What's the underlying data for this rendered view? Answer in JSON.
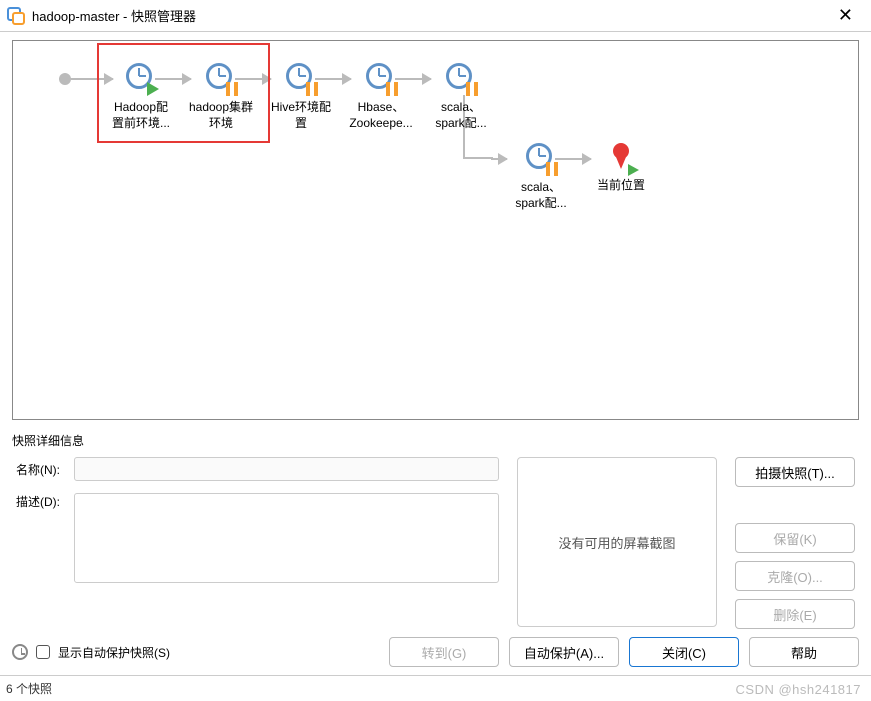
{
  "window": {
    "title": "hadoop-master - 快照管理器",
    "close_glyph": "✕"
  },
  "snapshots": [
    {
      "id": "n1",
      "label1": "Hadoop配",
      "label2": "置前环境...",
      "badge": "play"
    },
    {
      "id": "n2",
      "label1": "hadoop集群",
      "label2": "环境",
      "badge": "pause"
    },
    {
      "id": "n3",
      "label1": "Hive环境配",
      "label2": "置",
      "badge": "pause"
    },
    {
      "id": "n4",
      "label1": "Hbase、",
      "label2": "Zookeepe...",
      "badge": "pause"
    },
    {
      "id": "n5",
      "label1": "scala、",
      "label2": "spark配...",
      "badge": "pause"
    },
    {
      "id": "n6",
      "label1": "scala、",
      "label2": "spark配...",
      "badge": "pause"
    },
    {
      "id": "n7",
      "label1": "当前位置",
      "label2": "",
      "badge": "current"
    }
  ],
  "details": {
    "header": "快照详细信息",
    "name_label": "名称(N):",
    "desc_label": "描述(D):",
    "name_value": "",
    "desc_value": "",
    "no_screenshot": "没有可用的屏幕截图"
  },
  "side_buttons": {
    "take": "拍摄快照(T)...",
    "keep": "保留(K)",
    "clone": "克隆(O)...",
    "delete": "删除(E)"
  },
  "bottom": {
    "show_autoprotect": "显示自动保护快照(S)",
    "goto": "转到(G)",
    "autoprotect": "自动保护(A)...",
    "close": "关闭(C)",
    "help": "帮助"
  },
  "status": {
    "count": "6 个快照"
  },
  "watermark": "CSDN @hsh241817"
}
